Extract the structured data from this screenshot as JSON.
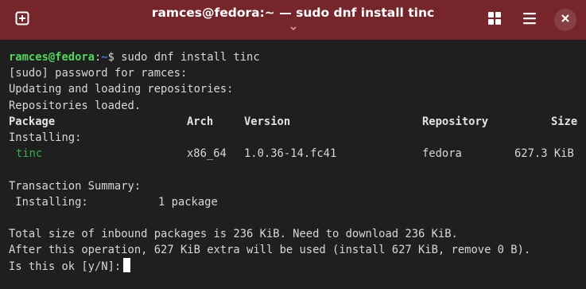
{
  "window": {
    "title": "ramces@fedora:~ — sudo dnf install tinc"
  },
  "icons": {
    "new_tab": "new-tab-icon",
    "grid": "grid-icon",
    "menu": "hamburger-menu-icon",
    "close": "close-icon",
    "chevron": "chevron-down-icon"
  },
  "colors": {
    "titlebar": "#76262a",
    "background": "#1f1f1f",
    "prompt_user": "#4fd85c",
    "prompt_path": "#3f7ee6",
    "package_name": "#38b24a"
  },
  "terminal": {
    "prompt": {
      "user_host": "ramces@fedora",
      "separator": ":",
      "path": "~",
      "symbol": "$",
      "command": " sudo dnf install tinc"
    },
    "lines_pre": [
      "[sudo] password for ramces:",
      "Updating and loading repositories:",
      "Repositories loaded."
    ],
    "table": {
      "headers": {
        "package": "Package",
        "arch": "Arch",
        "version": "Version",
        "repository": "Repository",
        "size": "Size"
      },
      "section": "Installing:",
      "row": {
        "name": "tinc",
        "arch": "x86_64",
        "version": "1.0.36-14.fc41",
        "repository": "fedora",
        "size": "627.3 KiB"
      }
    },
    "summary": {
      "title": "Transaction Summary:",
      "label": " Installing:",
      "value": "1 package"
    },
    "info_lines": [
      "Total size of inbound packages is 236 KiB. Need to download 236 KiB.",
      "After this operation, 627 KiB extra will be used (install 627 KiB, remove 0 B)."
    ],
    "question": "Is this ok [y/N]:"
  }
}
